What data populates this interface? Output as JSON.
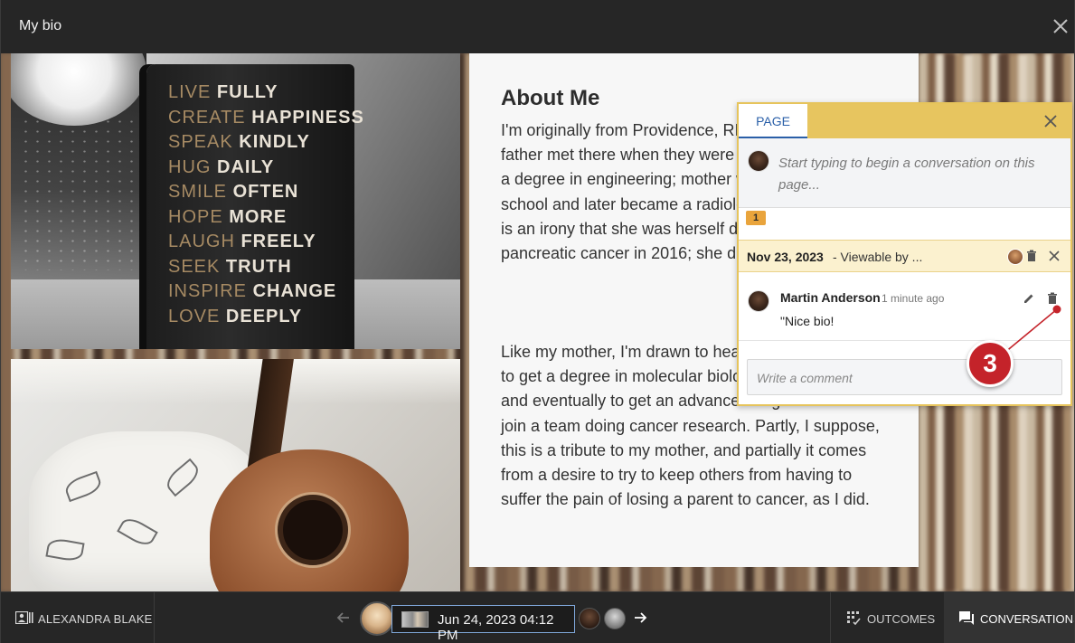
{
  "header": {
    "title": "My bio",
    "close_icon": "close-icon"
  },
  "photos": {
    "book_quote": [
      {
        "a": "LIVE",
        "b": "FULLY"
      },
      {
        "a": "CREATE",
        "b": "HAPPINESS"
      },
      {
        "a": "SPEAK",
        "b": "KINDLY"
      },
      {
        "a": "HUG",
        "b": "DAILY"
      },
      {
        "a": "SMILE",
        "b": "OFTEN"
      },
      {
        "a": "HOPE",
        "b": "MORE"
      },
      {
        "a": "LAUGH",
        "b": "FREELY"
      },
      {
        "a": "SEEK",
        "b": "TRUTH"
      },
      {
        "a": "INSPIRE",
        "b": "CHANGE"
      },
      {
        "a": "LOVE",
        "b": "DEEPLY"
      }
    ]
  },
  "article": {
    "heading": "About Me",
    "paragraph1": "I'm originally from Providence, RI. My mother and father met there when they were students. Father got a degree in engineering; mother went to medical school and later became a radiological oncologist. It is an irony that she was herself diagnosed with pancreatic cancer in 2016; she died a year later.",
    "paragraph2": "Like my mother, I'm drawn to health care. My plan is to get a degree in molecular biology or biochemistry and eventually to get an advanced degree. I want to join a team doing cancer research. Partly, I suppose, this is a tribute to my mother, and partially it comes from a desire to try to keep others from having to suffer the pain of losing a parent to cancer, as I did."
  },
  "conversation": {
    "tab_label": "PAGE",
    "new_placeholder": "Start typing to begin a conversation on this page...",
    "marker_count": "1",
    "thread_date": "Nov 23, 2023",
    "thread_visibility": "- Viewable by ...",
    "comment": {
      "author": "Martin Anderson",
      "time": "1 minute ago",
      "text": "\"Nice bio!"
    },
    "write_placeholder": "Write a comment"
  },
  "callout": {
    "number": "3",
    "color": "#c4232a"
  },
  "footer": {
    "owner_name": "ALEXANDRA BLAKE",
    "date": "Jun 24, 2023 04:12 PM",
    "outcomes_label": "OUTCOMES",
    "conversations_label": "CONVERSATIONS"
  },
  "colors": {
    "accent": "#2a5fa8",
    "popup_border": "#e6c45c",
    "thread_bg": "#fbf1cf",
    "marker": "#e9a43c"
  }
}
